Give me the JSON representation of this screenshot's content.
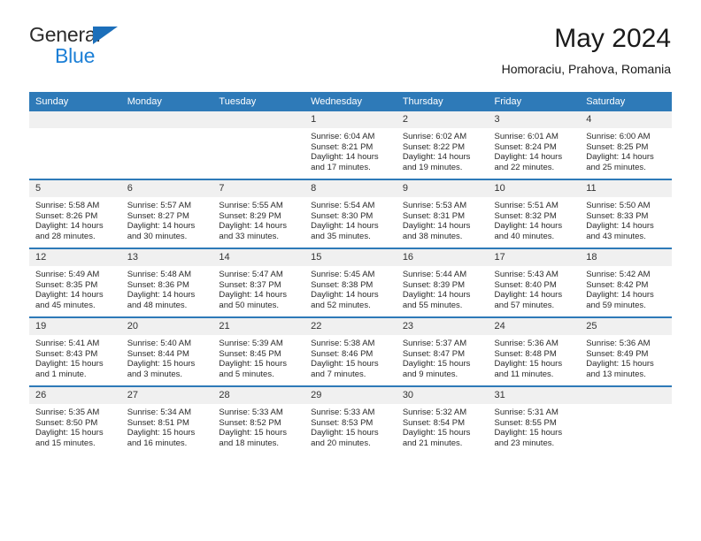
{
  "logo": {
    "line1": "General",
    "line2": "Blue",
    "flag_color": "#1c6fba",
    "blue_color": "#1c7fd6"
  },
  "header": {
    "month_title": "May 2024",
    "location": "Homoraciu, Prahova, Romania"
  },
  "theme": {
    "header_blue": "#2e7ab8",
    "daynum_bg": "#f0f0f0",
    "text": "#2a2a2a"
  },
  "weekday_headers": [
    "Sunday",
    "Monday",
    "Tuesday",
    "Wednesday",
    "Thursday",
    "Friday",
    "Saturday"
  ],
  "labels": {
    "sunrise": "Sunrise:",
    "sunset": "Sunset:",
    "daylight": "Daylight:"
  },
  "weeks": [
    [
      {
        "day": "",
        "sunrise": "",
        "sunset": "",
        "daylight": "",
        "empty": true
      },
      {
        "day": "",
        "sunrise": "",
        "sunset": "",
        "daylight": "",
        "empty": true
      },
      {
        "day": "",
        "sunrise": "",
        "sunset": "",
        "daylight": "",
        "empty": true
      },
      {
        "day": "1",
        "sunrise": "Sunrise: 6:04 AM",
        "sunset": "Sunset: 8:21 PM",
        "daylight": "Daylight: 14 hours and 17 minutes."
      },
      {
        "day": "2",
        "sunrise": "Sunrise: 6:02 AM",
        "sunset": "Sunset: 8:22 PM",
        "daylight": "Daylight: 14 hours and 19 minutes."
      },
      {
        "day": "3",
        "sunrise": "Sunrise: 6:01 AM",
        "sunset": "Sunset: 8:24 PM",
        "daylight": "Daylight: 14 hours and 22 minutes."
      },
      {
        "day": "4",
        "sunrise": "Sunrise: 6:00 AM",
        "sunset": "Sunset: 8:25 PM",
        "daylight": "Daylight: 14 hours and 25 minutes."
      }
    ],
    [
      {
        "day": "5",
        "sunrise": "Sunrise: 5:58 AM",
        "sunset": "Sunset: 8:26 PM",
        "daylight": "Daylight: 14 hours and 28 minutes."
      },
      {
        "day": "6",
        "sunrise": "Sunrise: 5:57 AM",
        "sunset": "Sunset: 8:27 PM",
        "daylight": "Daylight: 14 hours and 30 minutes."
      },
      {
        "day": "7",
        "sunrise": "Sunrise: 5:55 AM",
        "sunset": "Sunset: 8:29 PM",
        "daylight": "Daylight: 14 hours and 33 minutes."
      },
      {
        "day": "8",
        "sunrise": "Sunrise: 5:54 AM",
        "sunset": "Sunset: 8:30 PM",
        "daylight": "Daylight: 14 hours and 35 minutes."
      },
      {
        "day": "9",
        "sunrise": "Sunrise: 5:53 AM",
        "sunset": "Sunset: 8:31 PM",
        "daylight": "Daylight: 14 hours and 38 minutes."
      },
      {
        "day": "10",
        "sunrise": "Sunrise: 5:51 AM",
        "sunset": "Sunset: 8:32 PM",
        "daylight": "Daylight: 14 hours and 40 minutes."
      },
      {
        "day": "11",
        "sunrise": "Sunrise: 5:50 AM",
        "sunset": "Sunset: 8:33 PM",
        "daylight": "Daylight: 14 hours and 43 minutes."
      }
    ],
    [
      {
        "day": "12",
        "sunrise": "Sunrise: 5:49 AM",
        "sunset": "Sunset: 8:35 PM",
        "daylight": "Daylight: 14 hours and 45 minutes."
      },
      {
        "day": "13",
        "sunrise": "Sunrise: 5:48 AM",
        "sunset": "Sunset: 8:36 PM",
        "daylight": "Daylight: 14 hours and 48 minutes."
      },
      {
        "day": "14",
        "sunrise": "Sunrise: 5:47 AM",
        "sunset": "Sunset: 8:37 PM",
        "daylight": "Daylight: 14 hours and 50 minutes."
      },
      {
        "day": "15",
        "sunrise": "Sunrise: 5:45 AM",
        "sunset": "Sunset: 8:38 PM",
        "daylight": "Daylight: 14 hours and 52 minutes."
      },
      {
        "day": "16",
        "sunrise": "Sunrise: 5:44 AM",
        "sunset": "Sunset: 8:39 PM",
        "daylight": "Daylight: 14 hours and 55 minutes."
      },
      {
        "day": "17",
        "sunrise": "Sunrise: 5:43 AM",
        "sunset": "Sunset: 8:40 PM",
        "daylight": "Daylight: 14 hours and 57 minutes."
      },
      {
        "day": "18",
        "sunrise": "Sunrise: 5:42 AM",
        "sunset": "Sunset: 8:42 PM",
        "daylight": "Daylight: 14 hours and 59 minutes."
      }
    ],
    [
      {
        "day": "19",
        "sunrise": "Sunrise: 5:41 AM",
        "sunset": "Sunset: 8:43 PM",
        "daylight": "Daylight: 15 hours and 1 minute."
      },
      {
        "day": "20",
        "sunrise": "Sunrise: 5:40 AM",
        "sunset": "Sunset: 8:44 PM",
        "daylight": "Daylight: 15 hours and 3 minutes."
      },
      {
        "day": "21",
        "sunrise": "Sunrise: 5:39 AM",
        "sunset": "Sunset: 8:45 PM",
        "daylight": "Daylight: 15 hours and 5 minutes."
      },
      {
        "day": "22",
        "sunrise": "Sunrise: 5:38 AM",
        "sunset": "Sunset: 8:46 PM",
        "daylight": "Daylight: 15 hours and 7 minutes."
      },
      {
        "day": "23",
        "sunrise": "Sunrise: 5:37 AM",
        "sunset": "Sunset: 8:47 PM",
        "daylight": "Daylight: 15 hours and 9 minutes."
      },
      {
        "day": "24",
        "sunrise": "Sunrise: 5:36 AM",
        "sunset": "Sunset: 8:48 PM",
        "daylight": "Daylight: 15 hours and 11 minutes."
      },
      {
        "day": "25",
        "sunrise": "Sunrise: 5:36 AM",
        "sunset": "Sunset: 8:49 PM",
        "daylight": "Daylight: 15 hours and 13 minutes."
      }
    ],
    [
      {
        "day": "26",
        "sunrise": "Sunrise: 5:35 AM",
        "sunset": "Sunset: 8:50 PM",
        "daylight": "Daylight: 15 hours and 15 minutes."
      },
      {
        "day": "27",
        "sunrise": "Sunrise: 5:34 AM",
        "sunset": "Sunset: 8:51 PM",
        "daylight": "Daylight: 15 hours and 16 minutes."
      },
      {
        "day": "28",
        "sunrise": "Sunrise: 5:33 AM",
        "sunset": "Sunset: 8:52 PM",
        "daylight": "Daylight: 15 hours and 18 minutes."
      },
      {
        "day": "29",
        "sunrise": "Sunrise: 5:33 AM",
        "sunset": "Sunset: 8:53 PM",
        "daylight": "Daylight: 15 hours and 20 minutes."
      },
      {
        "day": "30",
        "sunrise": "Sunrise: 5:32 AM",
        "sunset": "Sunset: 8:54 PM",
        "daylight": "Daylight: 15 hours and 21 minutes."
      },
      {
        "day": "31",
        "sunrise": "Sunrise: 5:31 AM",
        "sunset": "Sunset: 8:55 PM",
        "daylight": "Daylight: 15 hours and 23 minutes."
      },
      {
        "day": "",
        "sunrise": "",
        "sunset": "",
        "daylight": "",
        "empty": true
      }
    ]
  ]
}
